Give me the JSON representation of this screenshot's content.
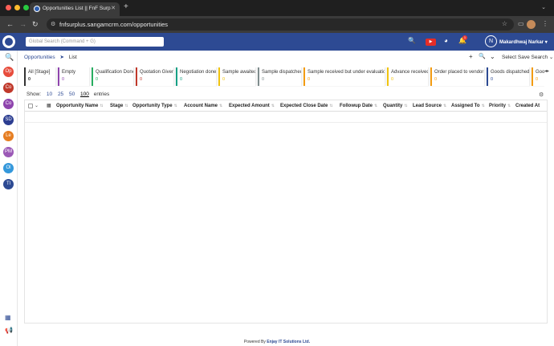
{
  "browser": {
    "tab_title": "Opportunities List || FnF Surp",
    "url": "fnfsurplus.sangamcrm.com/opportunities"
  },
  "header": {
    "search_placeholder": "Global Search (Command + G)",
    "notification_count": "1",
    "user_initial": "N",
    "user_name": "Makardhwaj Narkar",
    "youtube_label": "▶"
  },
  "rail": {
    "items": [
      {
        "label": "Op",
        "color": "#e74c3c"
      },
      {
        "label": "Co",
        "color": "#c0392b"
      },
      {
        "label": "Co",
        "color": "#8e44ad"
      },
      {
        "label": "SD",
        "color": "#2c3e91"
      },
      {
        "label": "Le",
        "color": "#e67e22"
      },
      {
        "label": "PM",
        "color": "#9b59b6"
      },
      {
        "label": "Ol",
        "color": "#3498db"
      },
      {
        "label": "Tl",
        "color": "#2d4a93"
      }
    ]
  },
  "breadcrumb": {
    "module": "Opportunities",
    "separator": "➤",
    "page": "List"
  },
  "toolbar": {
    "save_search": "Select Save Search"
  },
  "stages": [
    {
      "name": "All [Stage]",
      "count": "0",
      "color": "#333333"
    },
    {
      "name": "Empty",
      "count": "0",
      "color": "#8e44ad"
    },
    {
      "name": "Qualification Done",
      "count": "0",
      "color": "#27ae60"
    },
    {
      "name": "Quotation Given",
      "count": "0",
      "color": "#c0392b"
    },
    {
      "name": "Negotiation done",
      "count": "0",
      "color": "#16a085"
    },
    {
      "name": "Sample awaited",
      "count": "0",
      "color": "#f1c40f"
    },
    {
      "name": "Sample dispatched",
      "count": "0",
      "color": "#7f8c8d"
    },
    {
      "name": "Sample received but under evaluation",
      "count": "0",
      "color": "#f39c12"
    },
    {
      "name": "Advance received",
      "count": "0",
      "color": "#f1c40f"
    },
    {
      "name": "Order placed to vendor",
      "count": "0",
      "color": "#f39c12"
    },
    {
      "name": "Goods dispatched",
      "count": "0",
      "color": "#2d4a93"
    },
    {
      "name": "Goo",
      "count": "0",
      "color": "#f39c12"
    }
  ],
  "entries": {
    "label_show": "Show:",
    "options": [
      "10",
      "25",
      "50",
      "100"
    ],
    "selected": "100",
    "label_entries": "entries"
  },
  "table": {
    "columns": [
      "Opportunity Name",
      "Stage",
      "Opportunity Type",
      "Account Name",
      "Expected Amount",
      "Expected Close Date",
      "Followup Date",
      "Quantity",
      "Lead Source",
      "Assigned To",
      "Priority",
      "Created At"
    ],
    "rows": []
  },
  "footer": {
    "prefix": "Powered By",
    "company": "Enjay IT Solutions Ltd."
  }
}
